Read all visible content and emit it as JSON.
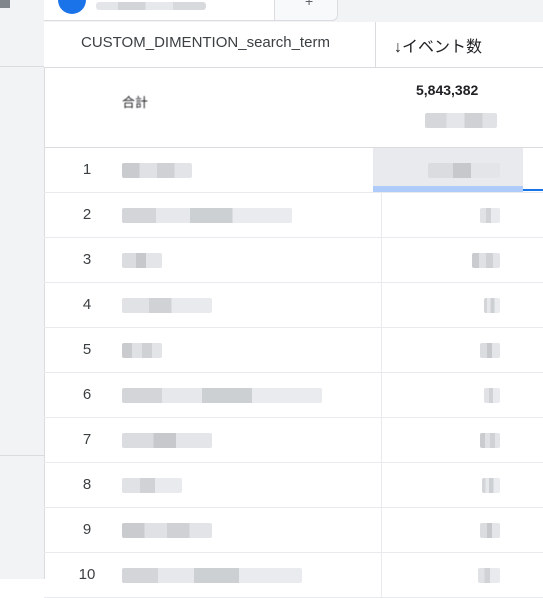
{
  "tabs": {
    "add_label": "+"
  },
  "table": {
    "dimension_header": "CUSTOM_DIMENTION_search_term",
    "metric_header": "↓イベント数",
    "total": {
      "label": "合計",
      "value": "5,843,382"
    },
    "rows": [
      {
        "rank": "1"
      },
      {
        "rank": "2"
      },
      {
        "rank": "3"
      },
      {
        "rank": "4"
      },
      {
        "rank": "5"
      },
      {
        "rank": "6"
      },
      {
        "rank": "7"
      },
      {
        "rank": "8"
      },
      {
        "rank": "9"
      },
      {
        "rank": "10"
      }
    ]
  },
  "colors": {
    "accent": "#1a73e8",
    "selection": "#aecbfa",
    "border": "#dadce0"
  }
}
